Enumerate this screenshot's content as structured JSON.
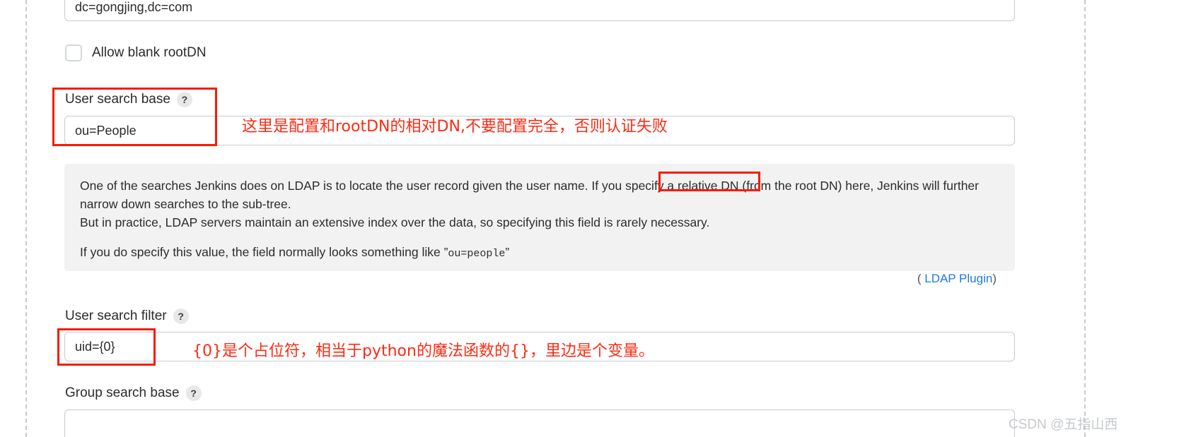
{
  "window": {
    "watermark": "CSDN @五指山西"
  },
  "fields": {
    "root_dn": {
      "value": "dc=gongjing,dc=com"
    },
    "allow_blank_root_dn": {
      "label": "Allow blank rootDN",
      "checked": false
    },
    "user_search_base": {
      "label": "User search base",
      "help_badge": "?",
      "value": "ou=People"
    },
    "user_search_filter": {
      "label": "User search filter",
      "help_badge": "?",
      "value": "uid={0}"
    },
    "group_search_base": {
      "label": "Group search base",
      "help_badge": "?",
      "value": ""
    }
  },
  "help_panel": {
    "line1_a": "One of the searches Jenkins does on LDAP is to locate the user record given the user name. If you specify ",
    "line1_highlight": "a relative DN (from the root DN)",
    "line1_b": " here, Jenkins will further",
    "line2": "narrow down searches to the sub-tree.",
    "line3": "But in practice, LDAP servers maintain an extensive index over the data, so specifying this field is rarely necessary.",
    "line4_a": "If you do specify this value, the field normally looks something like ",
    "line4_quote_open": "”",
    "line4_code": "ou=people",
    "line4_quote_close": "”",
    "footer_prefix": "( ",
    "footer_link": "LDAP Plugin",
    "footer_suffix": ")"
  },
  "annotations": {
    "user_search_base_note": "这里是配置和rootDN的相对DN,不要配置完全，否则认证失败",
    "user_search_filter_note": "{0}是个占位符，相当于python的魔法函数的{}，里边是个变量。"
  },
  "colors": {
    "annotation_red": "#fc2b14",
    "link_blue": "#1a7ae0",
    "help_bg": "#f2f2f2"
  }
}
